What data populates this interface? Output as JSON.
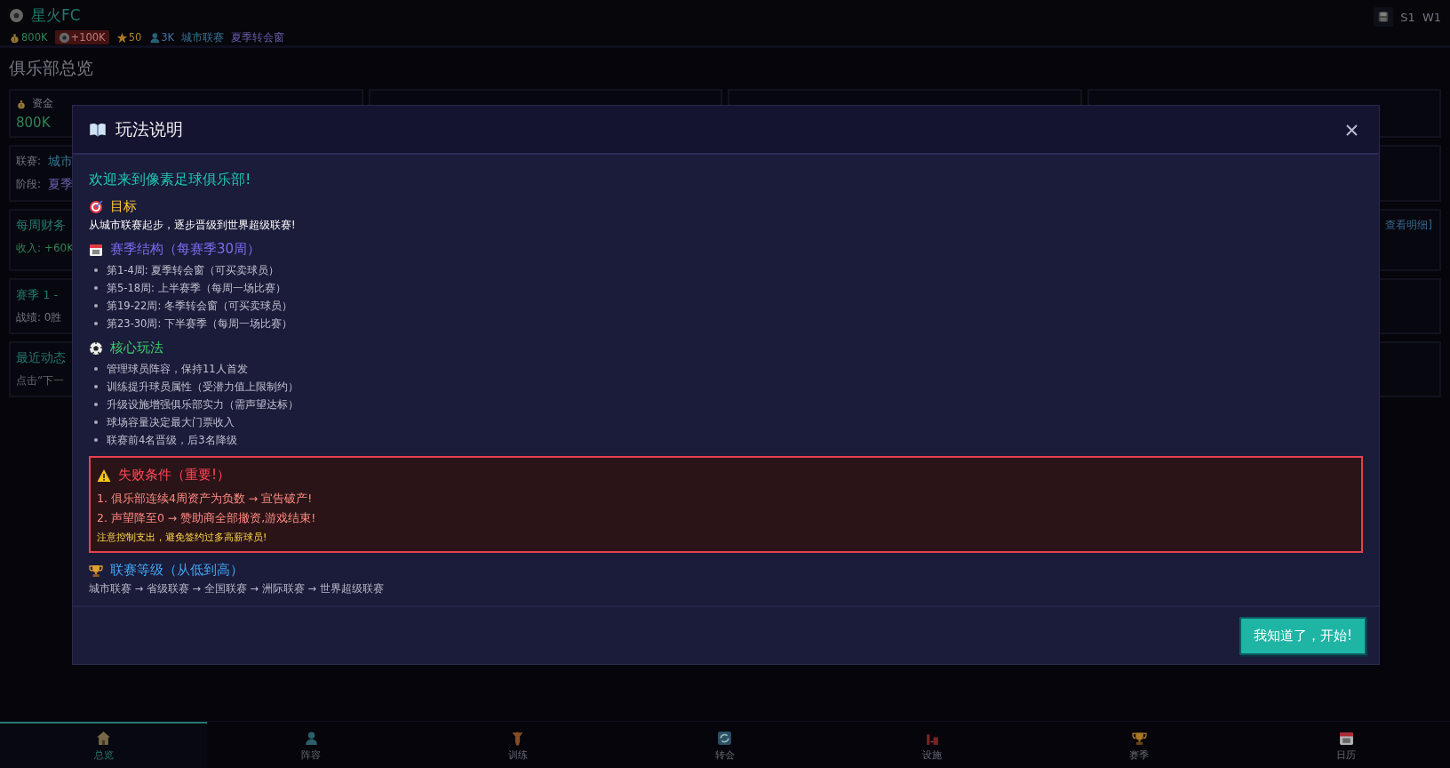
{
  "header": {
    "club": "星火FC",
    "stats": [
      {
        "kind": "money",
        "text": "800K"
      },
      {
        "kind": "change",
        "text": "+100K"
      },
      {
        "kind": "reputation",
        "text": "50"
      },
      {
        "kind": "fans",
        "text": "3K"
      },
      {
        "kind": "league",
        "text": "城市联赛"
      },
      {
        "kind": "phase",
        "text": "夏季转会窗"
      }
    ],
    "season": "S1",
    "week": "W1"
  },
  "page": {
    "title": "俱乐部总览",
    "stat_cards": [
      {
        "label": "资金",
        "value": "800K"
      }
    ],
    "info_rows": [
      {
        "label": "联赛:",
        "value": "城市"
      },
      {
        "label": "阶段:",
        "value": "夏季"
      }
    ],
    "finance": {
      "title": "每周财务",
      "income": "收入: +60K",
      "link": "查看明细]"
    },
    "season": {
      "title": "赛季 1 - ",
      "record": "战绩: 0胜"
    },
    "activity": {
      "title": "最近动态",
      "hint": "点击“下一"
    }
  },
  "modal": {
    "title": "玩法说明",
    "welcome": "欢迎来到像素足球俱乐部!",
    "sections": [
      {
        "kind": "text",
        "heading": "目标",
        "color": "#ffcc33",
        "text": "从城市联赛起步，逐步晋级到世界超级联赛!"
      },
      {
        "kind": "list",
        "heading": "赛季结构（每赛季30周）",
        "color": "#7b6cf0",
        "items": [
          "第1-4周: 夏季转会窗（可买卖球员）",
          "第5-18周: 上半赛季（每周一场比赛）",
          "第19-22周: 冬季转会窗（可买卖球员）",
          "第23-30周: 下半赛季（每周一场比赛）"
        ]
      },
      {
        "kind": "list",
        "heading": "核心玩法",
        "color": "#3ecf6e",
        "items": [
          "管理球员阵容，保持11人首发",
          "训练提升球员属性（受潜力值上限制约）",
          "升级设施增强俱乐部实力（需声望达标）",
          "球场容量决定最大门票收入",
          "联赛前4名晋级，后3名降级"
        ]
      },
      {
        "kind": "warning",
        "heading": "失败条件（重要!）",
        "color": "#ff4757",
        "items": [
          "1. 俱乐部连续4周资产为负数 → 宣告破产!",
          "2. 声望降至0 → 赞助商全部撤资,游戏结束!"
        ],
        "note": "注意控制支出，避免签约过多高薪球员!"
      },
      {
        "kind": "flow",
        "heading": "联赛等级（从低到高）",
        "color": "#3fa9f5",
        "text": "城市联赛 → 省级联赛 → 全国联赛 → 洲际联赛 → 世界超级联赛"
      }
    ],
    "button": "我知道了，开始!"
  },
  "nav": [
    {
      "label": "总览",
      "selected": true
    },
    {
      "label": "阵容",
      "selected": false
    },
    {
      "label": "训练",
      "selected": false
    },
    {
      "label": "转会",
      "selected": false
    },
    {
      "label": "设施",
      "selected": false
    },
    {
      "label": "赛季",
      "selected": false
    },
    {
      "label": "日历",
      "selected": false
    }
  ]
}
